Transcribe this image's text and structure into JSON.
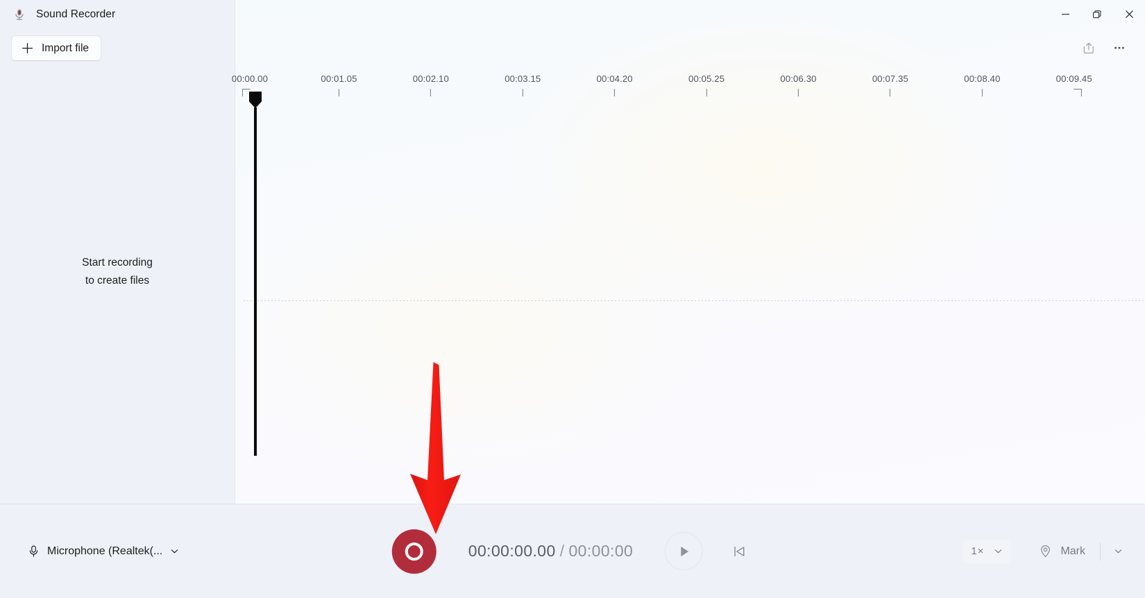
{
  "window": {
    "app_title": "Sound Recorder",
    "app_icon": "microphone-icon",
    "controls": [
      {
        "name": "minimize",
        "glyph": "minimize-icon"
      },
      {
        "name": "maximize",
        "glyph": "restore-icon"
      },
      {
        "name": "close",
        "glyph": "close-icon"
      }
    ]
  },
  "commandbar": {
    "share_icon": "share-icon",
    "more_icon": "more-options-icon"
  },
  "sidebar": {
    "import_label": "Import file",
    "import_icon": "plus-icon",
    "empty_line1": "Start recording",
    "empty_line2": "to create files"
  },
  "timeline": {
    "ticks": [
      {
        "label": "00:00.00",
        "x_pct": 1.6,
        "style": "corner-left"
      },
      {
        "label": "00:01.05",
        "x_pct": 11.4,
        "style": "line"
      },
      {
        "label": "00:02.10",
        "x_pct": 21.5,
        "style": "line"
      },
      {
        "label": "00:03.15",
        "x_pct": 31.6,
        "style": "line"
      },
      {
        "label": "00:04.20",
        "x_pct": 41.7,
        "style": "line"
      },
      {
        "label": "00:05.25",
        "x_pct": 51.8,
        "style": "line"
      },
      {
        "label": "00:06.30",
        "x_pct": 61.9,
        "style": "line"
      },
      {
        "label": "00:07.35",
        "x_pct": 72.0,
        "style": "line"
      },
      {
        "label": "00:08.40",
        "x_pct": 82.1,
        "style": "line"
      },
      {
        "label": "00:09.45",
        "x_pct": 92.2,
        "style": "corner-right"
      }
    ],
    "playhead_position": "00:00.00"
  },
  "bottombar": {
    "mic_label": "Microphone (Realtek(...",
    "mic_icon": "microphone-icon",
    "mic_chevron": "chevron-down-icon",
    "record_icon": "record-icon",
    "elapsed": "00:00:00.00",
    "separator": "/",
    "total": "00:00:00",
    "play_icon": "play-icon",
    "skip_back_icon": "skip-to-start-icon",
    "speed_value": "1",
    "speed_suffix": "×",
    "speed_chevron": "chevron-down-icon",
    "mark_label": "Mark",
    "mark_icon": "location-pin-icon",
    "mark_chevron": "chevron-down-icon"
  },
  "annotation": {
    "arrow_color": "#f21a14",
    "target": "record-button"
  },
  "colors": {
    "sidebar_bg": "#eef1f7",
    "main_bg": "#f7fafc",
    "record_red": "#b22d3c",
    "text_primary": "#1b1b1b",
    "text_muted": "#767c87",
    "annotation_red": "#f21a14"
  }
}
